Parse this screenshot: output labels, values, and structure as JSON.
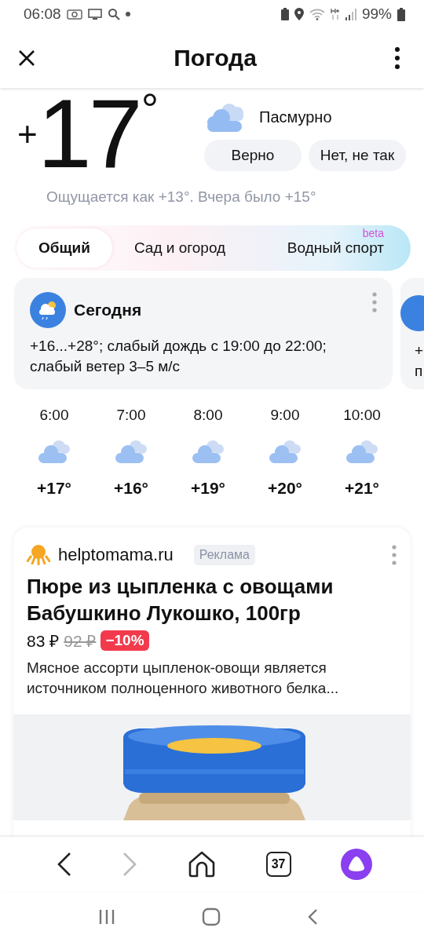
{
  "status_bar": {
    "time": "06:08",
    "battery": "99%"
  },
  "header": {
    "title": "Погода"
  },
  "current": {
    "sign": "+",
    "temp": "17",
    "degree": "°",
    "condition": "Пасмурно",
    "feedback": [
      "Верно",
      "Нет, не так"
    ],
    "feels": "Ощущается как +13°. Вчера было +15°"
  },
  "tabs": [
    {
      "label": "Общий",
      "selected": true
    },
    {
      "label": "Сад и огород",
      "selected": false
    },
    {
      "label": "Водный спорт",
      "selected": false,
      "badge": "beta"
    }
  ],
  "day_cards": [
    {
      "title": "Сегодня",
      "text": "+16...+28°; слабый дождь с 19:00 до 22:00; слабый ветер 3–5 м/с"
    },
    {
      "lines": [
        "+",
        "п"
      ]
    }
  ],
  "hourly": [
    {
      "time": "6:00",
      "temp": "+17°"
    },
    {
      "time": "7:00",
      "temp": "+16°"
    },
    {
      "time": "8:00",
      "temp": "+19°"
    },
    {
      "time": "9:00",
      "temp": "+20°"
    },
    {
      "time": "10:00",
      "temp": "+21°"
    }
  ],
  "ad": {
    "domain": "helptomama.ru",
    "label": "Реклама",
    "title": "Пюре из цыпленка с овощами Бабушкино Лукошко, 100гр",
    "price": "83 ₽",
    "old_price": "92 ₽",
    "discount": "−10%",
    "description": "Мясное ассорти цыпленок-овощи является источником полноценного животного белка..."
  },
  "browser_bar": {
    "forward_disabled": true,
    "tabs_count": "37"
  }
}
